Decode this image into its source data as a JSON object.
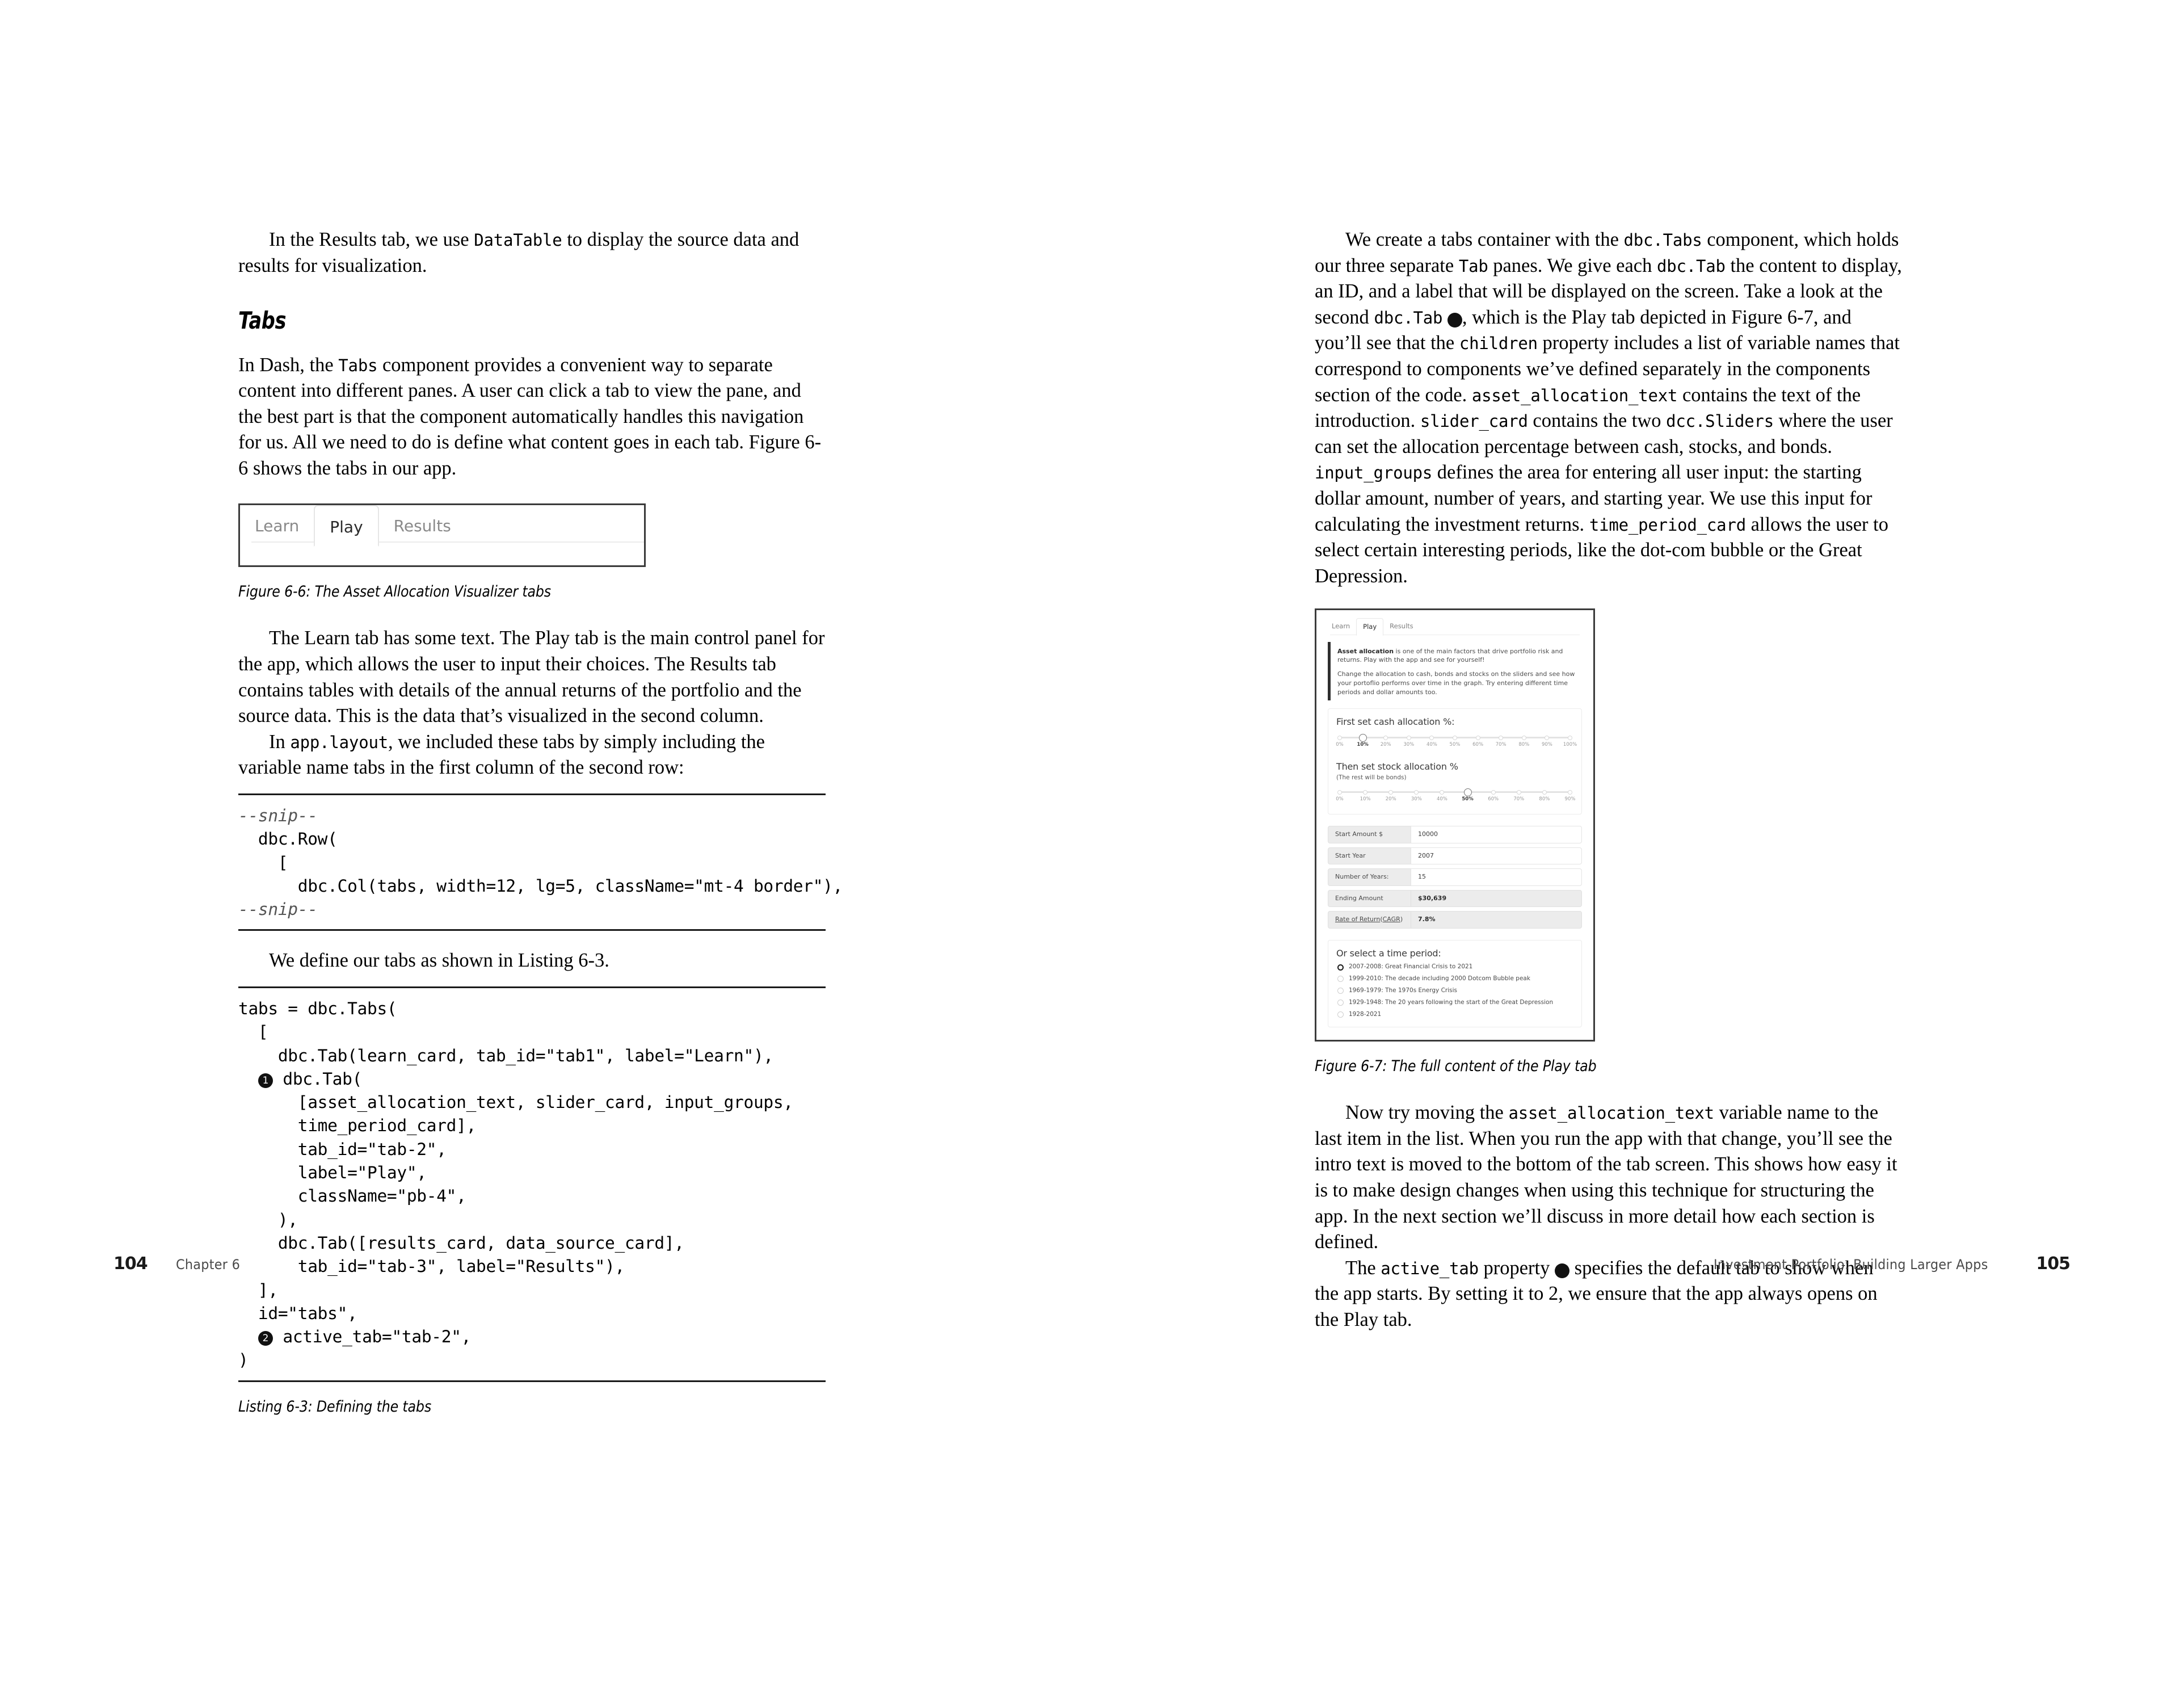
{
  "left_page": {
    "paragraphs": {
      "p1_pre": "In the Results tab, we use ",
      "p1_code": "DataTable",
      "p1_post": " to display the source data and results for visualization.",
      "heading": "Tabs",
      "p2_pre": "In Dash, the ",
      "p2_code": "Tabs",
      "p2_post": " component provides a convenient way to separate content into different panes. A user can click a tab to view the pane, and the best part is that the component automatically handles this navigation for us. All we need to do is define what content goes in each tab. Figure 6-6 shows the tabs in our app.",
      "p3": "The Learn tab has some text. The Play tab is the main control panel for the app, which allows the user to input their choices. The Results tab contains tables with details of the annual returns of the portfolio and the source data. This is the data that’s visualized in the second column.",
      "p4_pre": "In ",
      "p4_code": "app.layout",
      "p4_post": ", we included these tabs by simply including the variable name tabs in the first column of the second row:",
      "p5": "We define our tabs as shown in Listing 6-3."
    },
    "figure_6_6": {
      "caption": "Figure 6-6: The Asset Allocation Visualizer tabs",
      "tabs": [
        "Learn",
        "Play",
        "Results"
      ],
      "active_tab": "Play"
    },
    "snippet_code": "--snip--\n  dbc.Row(\n    [\n      dbc.Col(tabs, width=12, lg=5, className=\"mt-4 border\"),\n--snip--",
    "snippet_lines": [
      {
        "text": "--snip--",
        "italic": true
      },
      {
        "text": "  dbc.Row(",
        "italic": false
      },
      {
        "text": "    [",
        "italic": false
      },
      {
        "text": "      dbc.Col(tabs, width=12, lg=5, className=\"mt-4 border\"),",
        "italic": false
      },
      {
        "text": "--snip--",
        "italic": true
      }
    ],
    "listing_6_3": {
      "caption": "Listing 6-3: Defining the tabs",
      "lines": [
        {
          "marker": "",
          "text": "tabs = dbc.Tabs("
        },
        {
          "marker": "",
          "text": "  ["
        },
        {
          "marker": "",
          "text": "    dbc.Tab(learn_card, tab_id=\"tab1\", label=\"Learn\"),"
        },
        {
          "marker": "❶",
          "text": " dbc.Tab("
        },
        {
          "marker": "",
          "text": "      [asset_allocation_text, slider_card, input_groups,"
        },
        {
          "marker": "",
          "text": "      time_period_card],"
        },
        {
          "marker": "",
          "text": "      tab_id=\"tab-2\","
        },
        {
          "marker": "",
          "text": "      label=\"Play\","
        },
        {
          "marker": "",
          "text": "      className=\"pb-4\","
        },
        {
          "marker": "",
          "text": "    ),"
        },
        {
          "marker": "",
          "text": "    dbc.Tab([results_card, data_source_card],"
        },
        {
          "marker": "",
          "text": "      tab_id=\"tab-3\", label=\"Results\"),"
        },
        {
          "marker": "",
          "text": "  ],"
        },
        {
          "marker": "",
          "text": "  id=\"tabs\","
        },
        {
          "marker": "❷",
          "text": " active_tab=\"tab-2\","
        },
        {
          "marker": "",
          "text": ")"
        }
      ]
    },
    "footer": {
      "page_number": "104",
      "running_head": "Chapter 6"
    }
  },
  "right_page": {
    "paragraphs": {
      "p1": [
        {
          "t": "We create a tabs container with the ",
          "m": false
        },
        {
          "t": "dbc.Tabs",
          "m": true
        },
        {
          "t": " component, which holds our three separate ",
          "m": false
        },
        {
          "t": "Tab",
          "m": true
        },
        {
          "t": " panes. We give each ",
          "m": false
        },
        {
          "t": "dbc.Tab",
          "m": true
        },
        {
          "t": " the content to display, an ID, and a label that will be displayed on the screen. Take a look at the second ",
          "m": false
        },
        {
          "t": "dbc.Tab",
          "m": true
        },
        {
          "t": " ❶, which is the Play tab depicted in Figure 6-7, and you’ll see that the ",
          "m": false
        },
        {
          "t": "children",
          "m": true
        },
        {
          "t": " property includes a list of variable names that correspond to components we’ve defined separately in the components section of the code. ",
          "m": false
        },
        {
          "t": "asset_allocation_text",
          "m": true
        },
        {
          "t": " contains the text of the introduction. ",
          "m": false
        },
        {
          "t": "slider_card",
          "m": true
        },
        {
          "t": " contains the two ",
          "m": false
        },
        {
          "t": "dcc.Sliders",
          "m": true
        },
        {
          "t": " where the user can set the allocation percentage between cash, stocks, and bonds. ",
          "m": false
        },
        {
          "t": "input_groups",
          "m": true
        },
        {
          "t": " defines the area for entering all user input: the starting dollar amount, number of years, and starting year. We use this input for calculating the investment returns. ",
          "m": false
        },
        {
          "t": "time_period_card",
          "m": true
        },
        {
          "t": " allows the user to select certain interesting periods, like the dot-com bubble or the Great Depression.",
          "m": false
        }
      ],
      "p2": [
        {
          "t": "Now try moving the ",
          "m": false
        },
        {
          "t": "asset_allocation_text",
          "m": true
        },
        {
          "t": " variable name to the last item in the list. When you run the app with that change, you’ll see the intro text is moved to the bottom of the tab screen. This shows how easy it is to make design changes when using this technique for structuring the app. In the next section we’ll discuss in more detail how each section is defined.",
          "m": false
        }
      ],
      "p3": [
        {
          "t": "The ",
          "m": false
        },
        {
          "t": "active_tab",
          "m": true
        },
        {
          "t": " property ❷ specifies the default tab to show when the app starts. By setting it to 2, we ensure that the app always opens on the Play tab.",
          "m": false
        }
      ]
    },
    "figure_6_7": {
      "caption": "Figure 6-7: The full content of the Play tab",
      "tabs": [
        "Learn",
        "Play",
        "Results"
      ],
      "active_tab": "Play",
      "alert": {
        "lead_bold": "Asset allocation",
        "lead_rest": " is one of the main factors that drive portfolio risk and returns. Play with the app and see for yourself!",
        "body": "Change the allocation to cash, bonds and stocks on the sliders and see how your portoflio performs over time in the graph. Try entering different time periods and dollar amounts too."
      },
      "slider_card": {
        "cash_title": "First set cash allocation %:",
        "cash_labels": [
          "0%",
          "10%",
          "20%",
          "30%",
          "40%",
          "50%",
          "60%",
          "70%",
          "80%",
          "90%",
          "100%"
        ],
        "cash_value": "10%",
        "stock_title": "Then set stock allocation %",
        "stock_subtitle": "(The rest will be bonds)",
        "stock_labels": [
          "0%",
          "10%",
          "20%",
          "30%",
          "40%",
          "50%",
          "60%",
          "70%",
          "80%",
          "90%"
        ],
        "stock_value": "50%"
      },
      "input_groups": [
        {
          "label": "Start Amount $",
          "value": "10000",
          "readonly": false,
          "underline": false
        },
        {
          "label": "Start Year",
          "value": "2007",
          "readonly": false,
          "underline": false
        },
        {
          "label": "Number of Years:",
          "value": "15",
          "readonly": false,
          "underline": false
        },
        {
          "label": "Ending Amount",
          "value": "$30,639",
          "readonly": true,
          "underline": false
        },
        {
          "label": "Rate of Return(CAGR)",
          "value": "7.8%",
          "readonly": true,
          "underline": true
        }
      ],
      "time_period_card": {
        "title": "Or select a time period:",
        "options": [
          {
            "label": "2007-2008: Great Financial Crisis to 2021",
            "selected": true
          },
          {
            "label": "1999-2010: The decade including 2000 Dotcom Bubble peak",
            "selected": false
          },
          {
            "label": "1969-1979: The 1970s Energy Crisis",
            "selected": false
          },
          {
            "label": "1929-1948: The 20 years following the start of the Great Depression",
            "selected": false
          },
          {
            "label": "1928-2021",
            "selected": false
          }
        ]
      }
    },
    "footer": {
      "page_number": "105",
      "running_head": "Investment Portfolio: Building Larger Apps"
    }
  }
}
